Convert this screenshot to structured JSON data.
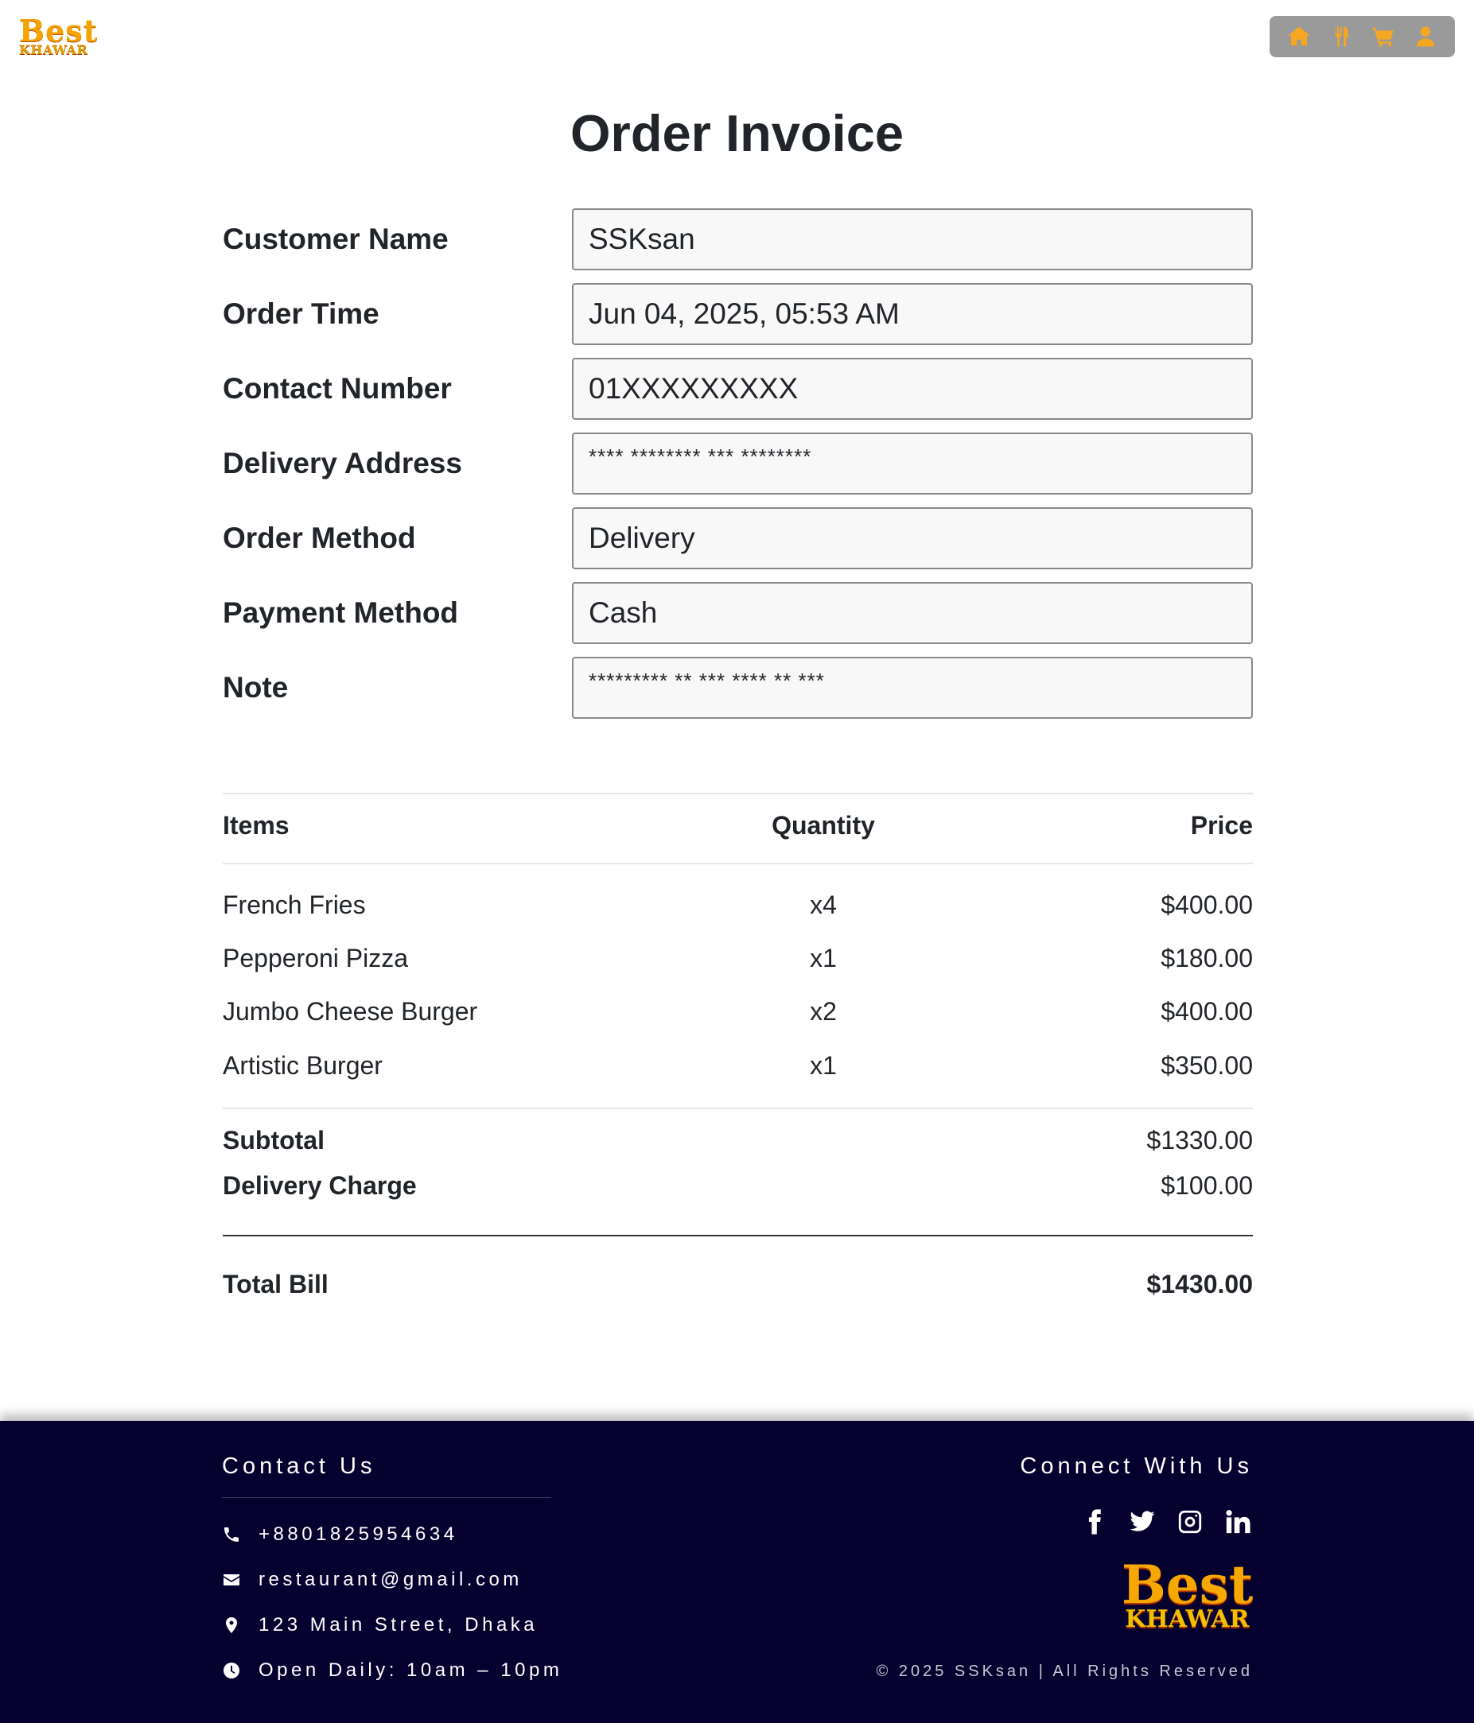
{
  "brand": {
    "line1": "Best",
    "line2": "KHAWAR"
  },
  "nav": [
    {
      "icon": "home-icon",
      "label": "Home"
    },
    {
      "icon": "food-icon",
      "label": "Menu"
    },
    {
      "icon": "cart-icon",
      "label": "Cart"
    },
    {
      "icon": "user-icon",
      "label": "Profile"
    }
  ],
  "title": "Order Invoice",
  "form": {
    "customer_name": {
      "label": "Customer Name",
      "value": "SSKsan"
    },
    "order_time": {
      "label": "Order Time",
      "value": "Jun 04, 2025, 05:53 AM"
    },
    "contact_number": {
      "label": "Contact Number",
      "value": "01XXXXXXXXX"
    },
    "delivery_address": {
      "label": "Delivery Address",
      "value": "**** ******** *** ********"
    },
    "order_method": {
      "label": "Order Method",
      "value": "Delivery"
    },
    "payment_method": {
      "label": "Payment Method",
      "value": "Cash"
    },
    "note": {
      "label": "Note",
      "value": "********* ** *** **** ** ***"
    }
  },
  "table": {
    "headers": {
      "items": "Items",
      "quantity": "Quantity",
      "price": "Price"
    },
    "rows": [
      {
        "item": "French Fries",
        "qty": "x4",
        "price": "$400.00"
      },
      {
        "item": "Pepperoni Pizza",
        "qty": "x1",
        "price": "$180.00"
      },
      {
        "item": "Jumbo Cheese Burger",
        "qty": "x2",
        "price": "$400.00"
      },
      {
        "item": "Artistic Burger",
        "qty": "x1",
        "price": "$350.00"
      }
    ],
    "subtotal": {
      "label": "Subtotal",
      "value": "$1330.00"
    },
    "delivery_charge": {
      "label": "Delivery Charge",
      "value": "$100.00"
    },
    "total": {
      "label": "Total Bill",
      "value": "$1430.00"
    }
  },
  "footer": {
    "contact_title": "Contact Us",
    "phone": "+8801825954634",
    "email": "restaurant@gmail.com",
    "address": "123 Main Street, Dhaka",
    "hours": "Open Daily: 10am – 10pm",
    "connect_title": "Connect With Us",
    "social": [
      "facebook-icon",
      "twitter-icon",
      "instagram-icon",
      "linkedin-icon"
    ],
    "copyright": "© 2025 SSKsan | All Rights Reserved"
  },
  "colors": {
    "accent": "#f5a623",
    "footer_bg": "#05002e",
    "nav_bg": "#9a9a9a"
  }
}
